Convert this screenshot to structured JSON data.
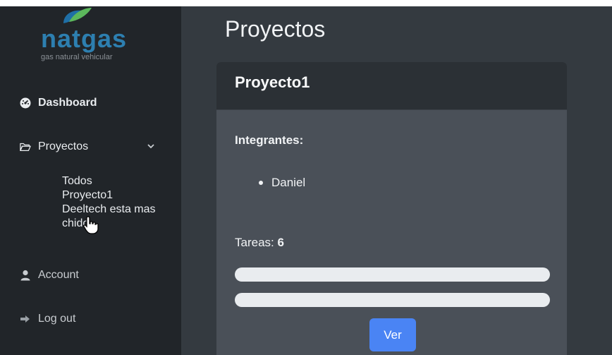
{
  "brand": {
    "name": "natgas",
    "tagline": "gas natural vehicular",
    "colors": {
      "primary": "#2d7fb0",
      "leaf_dark": "#1f6fa6",
      "leaf_green": "#5cb85c"
    }
  },
  "sidebar": {
    "items": [
      {
        "label": "Dashboard",
        "icon": "dashboard-gauge-icon"
      },
      {
        "label": "Proyectos",
        "icon": "folder-open-icon",
        "expanded": true
      },
      {
        "label": "Account",
        "icon": "user-icon"
      },
      {
        "label": "Log out",
        "icon": "logout-icon"
      }
    ],
    "projects_submenu": [
      "Todos",
      "Proyecto1",
      "Deeltech esta mas chido"
    ]
  },
  "main": {
    "page_title": "Proyectos",
    "card": {
      "title": "Proyecto1",
      "members_label": "Integrantes:",
      "members": [
        "Daniel"
      ],
      "tasks_label": "Tareas:",
      "tasks_count": "6",
      "progress_bars": [
        0,
        0
      ],
      "view_button": "Ver"
    }
  },
  "colors": {
    "sidebar_bg": "#212529",
    "main_bg": "#343a40",
    "card_bg": "#4a5058",
    "card_header_bg": "#2b3035",
    "button_primary": "#4a84f4"
  }
}
